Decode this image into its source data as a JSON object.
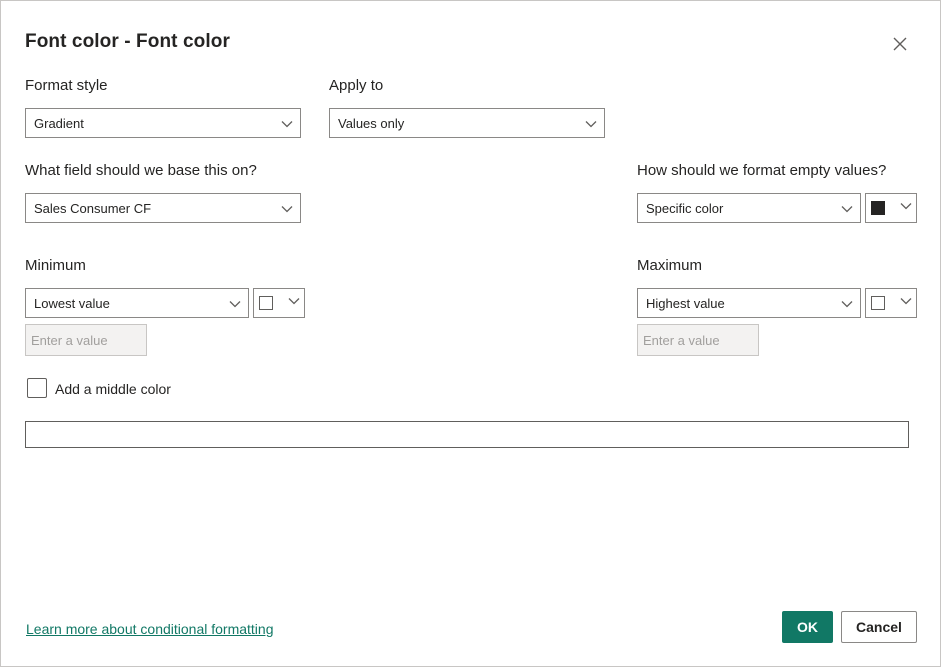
{
  "dialog": {
    "title": "Font color - Font color",
    "close_icon": "close-icon"
  },
  "format_style": {
    "label": "Format style",
    "value": "Gradient"
  },
  "apply_to": {
    "label": "Apply to",
    "value": "Values only"
  },
  "base_field": {
    "label": "What field should we base this on?",
    "value": "Sales Consumer CF"
  },
  "empty_values": {
    "label": "How should we format empty values?",
    "value": "Specific color",
    "color": "#252423"
  },
  "minimum": {
    "label": "Minimum",
    "value": "Lowest value",
    "color": "#ffffff",
    "placeholder": "Enter a value"
  },
  "maximum": {
    "label": "Maximum",
    "value": "Highest value",
    "color": "#ffffff",
    "placeholder": "Enter a value"
  },
  "middle_color": {
    "label": "Add a middle color",
    "checked": false
  },
  "footer": {
    "learn_more": "Learn more about conditional formatting",
    "ok": "OK",
    "cancel": "Cancel"
  },
  "colors": {
    "accent": "#117865",
    "border": "#8a8886",
    "text": "#252423"
  }
}
